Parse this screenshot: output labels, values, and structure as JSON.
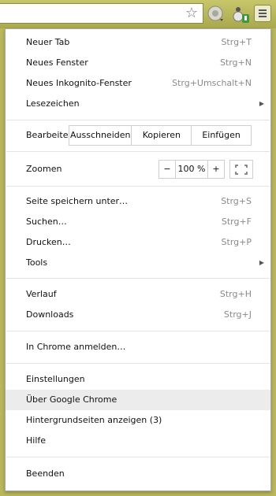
{
  "menu": {
    "section1": [
      {
        "label": "Neuer Tab",
        "shortcut": "Strg+T"
      },
      {
        "label": "Neues Fenster",
        "shortcut": "Strg+N"
      },
      {
        "label": "Neues Inkognito-Fenster",
        "shortcut": "Strg+Umschalt+N"
      },
      {
        "label": "Lesezeichen",
        "shortcut": ""
      }
    ],
    "edit": {
      "label": "Bearbeiten",
      "cut": "Ausschneiden",
      "copy": "Kopieren",
      "paste": "Einfügen"
    },
    "zoom": {
      "label": "Zoomen",
      "minus": "−",
      "value": "100 %",
      "plus": "+"
    },
    "section3": [
      {
        "label": "Seite speichern unter…",
        "shortcut": "Strg+S"
      },
      {
        "label": "Suchen…",
        "shortcut": "Strg+F"
      },
      {
        "label": "Drucken…",
        "shortcut": "Strg+P"
      },
      {
        "label": "Tools",
        "shortcut": ""
      }
    ],
    "section4": [
      {
        "label": "Verlauf",
        "shortcut": "Strg+H"
      },
      {
        "label": "Downloads",
        "shortcut": "Strg+J"
      }
    ],
    "signin": "In Chrome anmelden…",
    "section6": [
      {
        "label": "Einstellungen"
      },
      {
        "label": "Über Google Chrome"
      },
      {
        "label": "Hintergrundseiten anzeigen (3)"
      },
      {
        "label": "Hilfe"
      }
    ],
    "exit": "Beenden"
  },
  "icons": {
    "bookmark": "star-icon",
    "extension1": "gear-extension-icon",
    "extension2": "extension-badge-icon",
    "menu": "hamburger-menu-icon"
  }
}
